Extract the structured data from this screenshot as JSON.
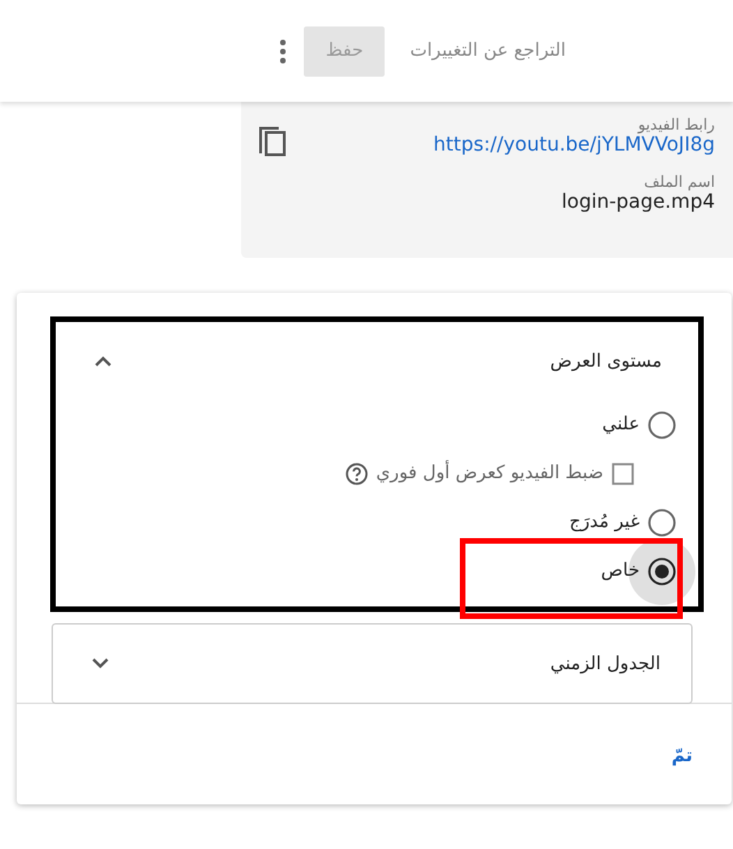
{
  "toolbar": {
    "revert_button": "التراجع عن التغييرات",
    "save_button": {
      "label": "حفظ",
      "disabled": true
    }
  },
  "details": [
    {
      "kind": "link",
      "label": "رابط الفيديو",
      "value": "https://youtu.be/jYLMVVoJI8g"
    },
    {
      "kind": "text",
      "label": "اسم الملف",
      "value": "login-page.mp4"
    }
  ],
  "sections": [
    {
      "title": "مستوى العرض",
      "expanded": true,
      "highlighted": true,
      "options": [
        {
          "kind": "radio",
          "label": "علني",
          "selected": false,
          "highlighted": false
        },
        {
          "kind": "checkbox",
          "label": "ضبط الفيديو كعرض أول فوري",
          "checked": false,
          "disabled": true,
          "help": true
        },
        {
          "kind": "radio",
          "label": "غير مُدرَج",
          "selected": false,
          "highlighted": false
        },
        {
          "kind": "radio",
          "label": "خاص",
          "selected": true,
          "highlighted": true
        }
      ]
    },
    {
      "title": "الجدول الزمني",
      "expanded": false,
      "highlighted": false
    }
  ],
  "done_button": "تمّ"
}
